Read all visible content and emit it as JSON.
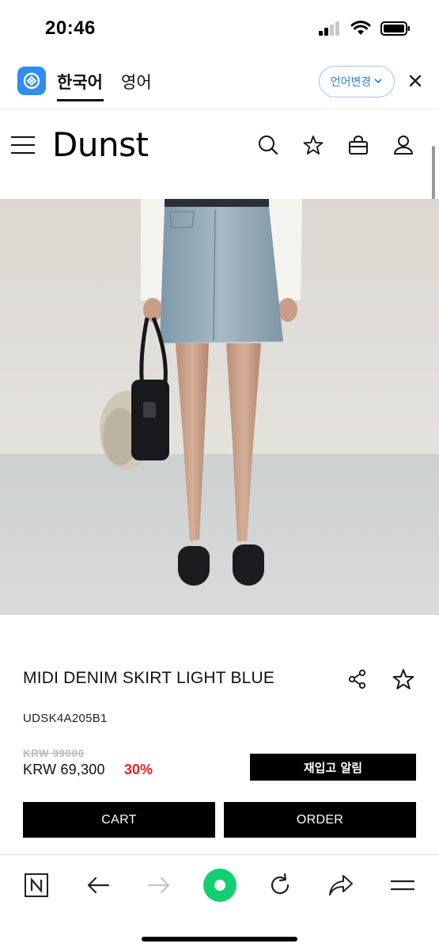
{
  "status_bar": {
    "time": "20:46",
    "icons": [
      "cellular-signal-icon",
      "wifi-icon",
      "battery-icon"
    ]
  },
  "translate_bar": {
    "app_icon": "papago-translate-icon",
    "tabs": [
      {
        "label": "한국어",
        "active": true
      },
      {
        "label": "영어",
        "active": false
      }
    ],
    "language_change_label": "언어변경",
    "accent_color": "#2f7fd8"
  },
  "site_header": {
    "brand": "Dunst",
    "icons": [
      "menu-icon",
      "search-icon",
      "star-icon",
      "shopping-bag-icon",
      "user-icon"
    ]
  },
  "product": {
    "image_alt": "model wearing light blue midi denim skirt with black bag and loafers",
    "name": "MIDI DENIM SKIRT LIGHT BLUE",
    "code": "UDSK4A205B1",
    "original_price": "KRW 99000",
    "sale_price": "KRW 69,300",
    "discount": "30%",
    "discount_color": "#e02424",
    "restock_label": "재입고 알림",
    "cart_label": "CART",
    "order_label": "ORDER"
  },
  "browser_toolbar": {
    "items": [
      "naver-n-icon",
      "back-arrow-icon",
      "forward-arrow-icon",
      "green-dot-icon",
      "reload-icon",
      "share-icon",
      "menu-icon"
    ],
    "green_color": "#10d072"
  }
}
